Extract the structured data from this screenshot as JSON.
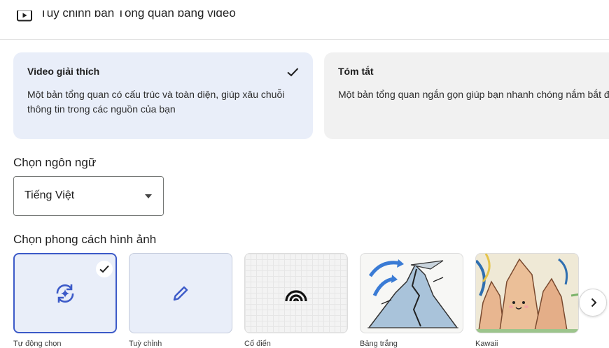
{
  "header": {
    "title": "Tuỳ chỉnh bản Tổng quan bằng video",
    "icon": "video-play-icon"
  },
  "formats": [
    {
      "title": "Video giải thích",
      "description": "Một bản tổng quan có cấu trúc và toàn diện, giúp xâu chuỗi thông tin trong các nguồn của bạn",
      "selected": true
    },
    {
      "title": "Tóm tắt",
      "description": "Một bản tổng quan ngắn gọn giúp bạn nhanh chóng nắm bắt được ý chính từ các nguồn của mình",
      "selected": false
    }
  ],
  "language": {
    "label": "Chọn ngôn ngữ",
    "value": "Tiếng Việt"
  },
  "visual_style": {
    "label": "Chọn phong cách hình ảnh",
    "tiles": [
      {
        "label": "Tự động chọn",
        "icon": "auto-sparkle-icon",
        "selected": true
      },
      {
        "label": "Tuỳ chỉnh",
        "icon": "pencil-icon",
        "selected": false
      },
      {
        "label": "Cổ điển",
        "icon": "rainbow-arcs-icon",
        "selected": false
      },
      {
        "label": "Bảng trắng",
        "icon": "volcano-sketch-image",
        "selected": false
      },
      {
        "label": "Kawaii",
        "icon": "kawaii-mountains-image",
        "selected": false
      }
    ],
    "next_icon": "chevron-right-icon"
  },
  "colors": {
    "accent": "#3c5ac8",
    "selected_bg": "#e9eef9",
    "unselected_bg": "#f1f1f1"
  }
}
